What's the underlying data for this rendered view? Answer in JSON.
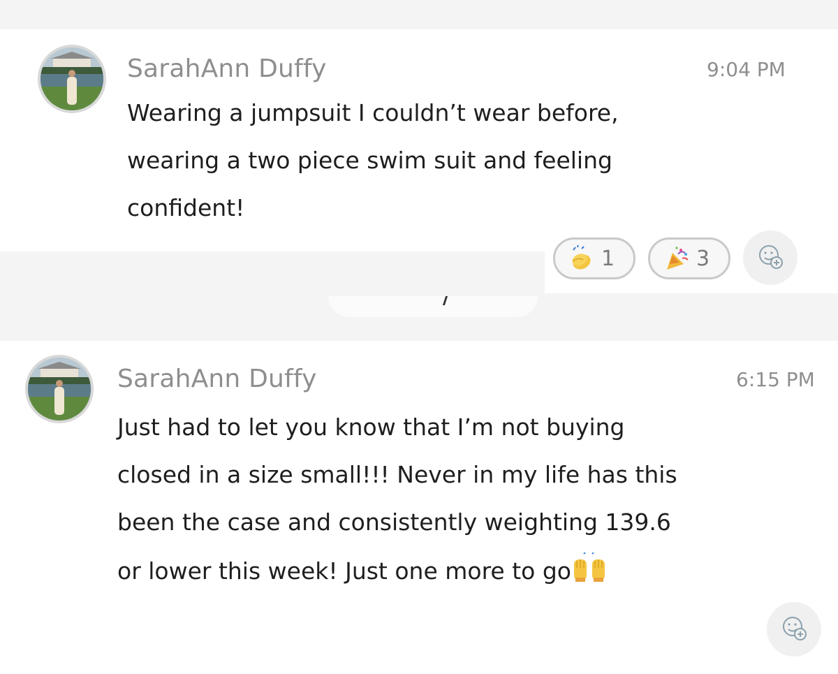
{
  "messages": [
    {
      "author": "SarahAnn Duffy",
      "time": "9:04 PM",
      "lines": [
        "Wearing a jumpsuit I couldn’t wear before,",
        "wearing a two piece swim suit and feeling",
        "confident!"
      ],
      "reactions": [
        {
          "icon": "clapping-hands-icon",
          "count": "1"
        },
        {
          "icon": "party-popper-icon",
          "count": "3"
        }
      ],
      "add_reaction_icon": "add-reaction-icon"
    },
    {
      "author": "SarahAnn Duffy",
      "time": "6:15 PM",
      "lines": [
        "Just had to let you know that I’m not buying",
        "closed in a size small!!! Never in my life has this",
        "been the case and consistently weighting 139.6",
        "or lower this week! Just one more to go"
      ],
      "trailing_emoji": "raising-hands-icon",
      "add_reaction_icon": "add-reaction-icon"
    }
  ],
  "colors": {
    "text": "#1e1e1e",
    "meta": "#8e8e8e",
    "pill_border": "#c9c9c9"
  }
}
